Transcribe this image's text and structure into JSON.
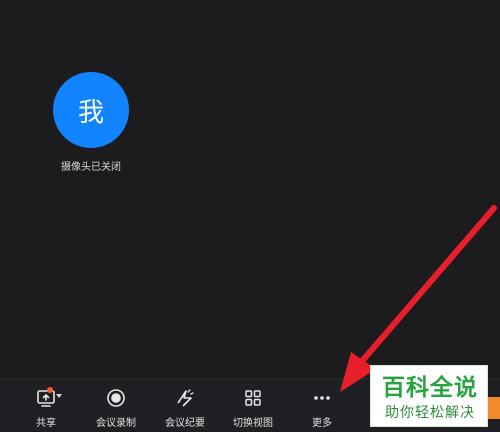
{
  "participant": {
    "avatar_text": "我",
    "camera_status": "摄像头已关闭"
  },
  "toolbar": {
    "buttons": [
      {
        "label": "共享",
        "icon": "share-screen-icon"
      },
      {
        "label": "会议录制",
        "icon": "record-icon"
      },
      {
        "label": "会议纪要",
        "icon": "meeting-notes-icon"
      },
      {
        "label": "切换视图",
        "icon": "switch-view-icon"
      },
      {
        "label": "更多",
        "icon": "more-icon"
      }
    ]
  },
  "watermark": {
    "title": "百科全说",
    "subtitle": "助你轻松解决"
  },
  "colors": {
    "background": "#1c1c1f",
    "toolbar": "#202024",
    "avatar": "#1384ff",
    "arrow": "#e81f2a",
    "watermark_green": "#27a43f",
    "share_badge": "#ff5a2b"
  }
}
